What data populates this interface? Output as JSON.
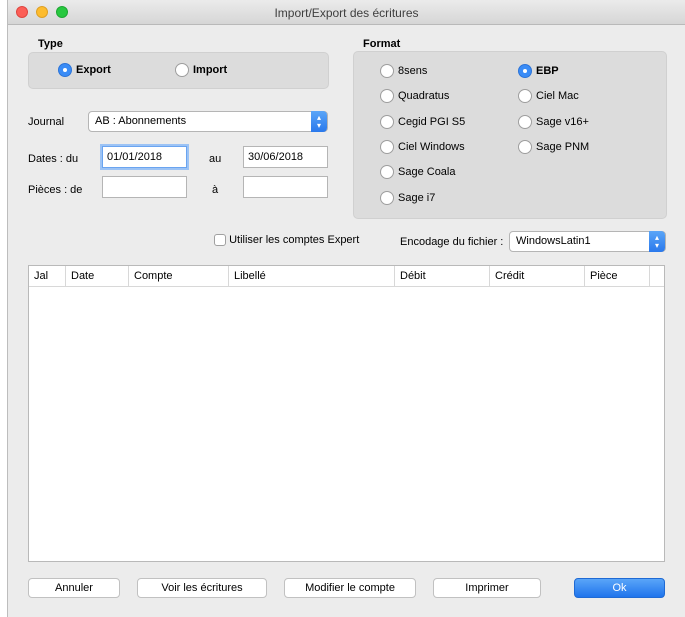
{
  "window": {
    "title": "Import/Export des écritures"
  },
  "type": {
    "label": "Type",
    "options": [
      {
        "label": "Export",
        "selected": true
      },
      {
        "label": "Import",
        "selected": false
      }
    ]
  },
  "format": {
    "label": "Format",
    "options": [
      {
        "label": "8sens",
        "selected": false
      },
      {
        "label": "EBP",
        "selected": true
      },
      {
        "label": "Quadratus",
        "selected": false
      },
      {
        "label": "Ciel Mac",
        "selected": false
      },
      {
        "label": "Cegid PGI S5",
        "selected": false
      },
      {
        "label": "Sage v16+",
        "selected": false
      },
      {
        "label": "Ciel Windows",
        "selected": false
      },
      {
        "label": "Sage PNM",
        "selected": false
      },
      {
        "label": "Sage Coala",
        "selected": false
      },
      {
        "label": "Sage i7",
        "selected": false
      }
    ]
  },
  "journal": {
    "label": "Journal",
    "value": "AB : Abonnements"
  },
  "dates": {
    "label": "Dates : du",
    "from": "01/01/2018",
    "to_label": "au",
    "to": "30/06/2018"
  },
  "pieces": {
    "label": "Pièces :  de",
    "from": "",
    "to_label": "à",
    "to": ""
  },
  "expert": {
    "label": "Utiliser les comptes Expert",
    "checked": false
  },
  "encoding": {
    "label": "Encodage du fichier :",
    "value": "WindowsLatin1"
  },
  "table": {
    "columns": [
      "Jal",
      "Date",
      "Compte",
      "Libellé",
      "Débit",
      "Crédit",
      "Pièce"
    ]
  },
  "buttons": {
    "cancel": "Annuler",
    "view": "Voir les écritures",
    "modify": "Modifier le compte",
    "print": "Imprimer",
    "ok": "Ok"
  },
  "colors": {
    "accent": "#3a8cf6",
    "background": "#ececec"
  }
}
